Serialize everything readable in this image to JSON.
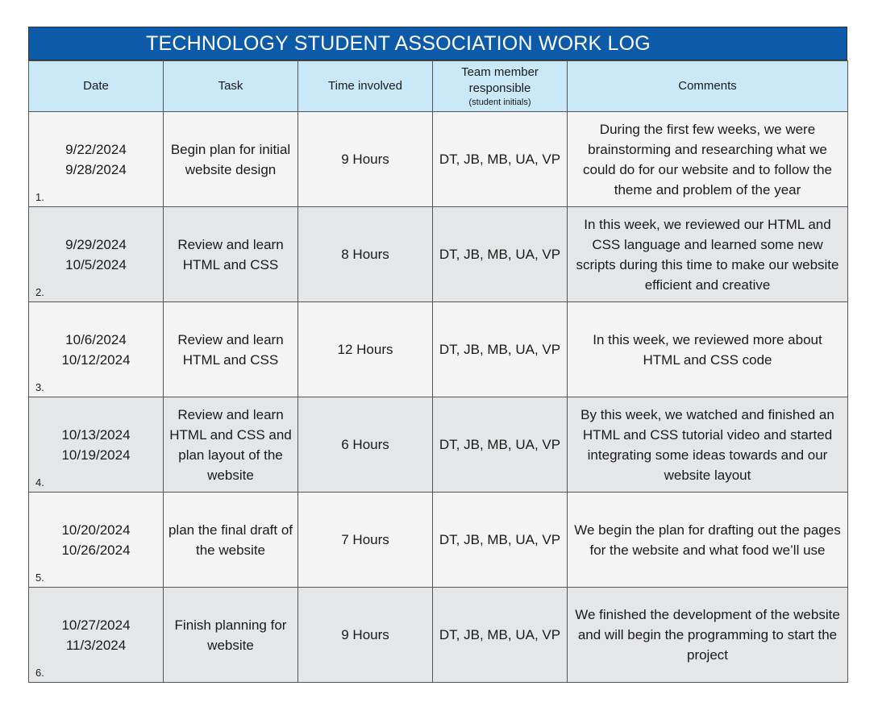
{
  "title": "TECHNOLOGY STUDENT ASSOCIATION WORK LOG",
  "headers": {
    "date": "Date",
    "task": "Task",
    "time": "Time involved",
    "team": "Team member responsible",
    "team_sub": "(student initials)",
    "comments": "Comments"
  },
  "rows": [
    {
      "num": "1.",
      "start": "9/22/2024",
      "end": "9/28/2024",
      "task": "Begin plan for initial website design",
      "time": "9 Hours",
      "team": "DT, JB, MB, UA, VP",
      "comment": "During the first few weeks, we were brainstorming and researching what we could do for our website and to follow the theme and problem of the year"
    },
    {
      "num": "2.",
      "start": "9/29/2024",
      "end": "10/5/2024",
      "task": "Review and learn HTML and CSS",
      "time": "8 Hours",
      "team": "DT, JB, MB, UA, VP",
      "comment": "In this week, we reviewed our HTML and CSS language and learned some new scripts during this time to make our website efficient and creative"
    },
    {
      "num": "3.",
      "start": "10/6/2024",
      "end": "10/12/2024",
      "task": "Review and learn HTML and CSS",
      "time": "12 Hours",
      "team": "DT, JB, MB, UA, VP",
      "comment": "In this week, we reviewed more about HTML and CSS code"
    },
    {
      "num": "4.",
      "start": "10/13/2024",
      "end": "10/19/2024",
      "task": "Review and learn HTML and CSS and plan layout of the website",
      "time": "6 Hours",
      "team": "DT, JB, MB, UA, VP",
      "comment": "By this week, we watched and finished an HTML and CSS tutorial video and started integrating some ideas towards and our website layout"
    },
    {
      "num": "5.",
      "start": "10/20/2024",
      "end": "10/26/2024",
      "task": "plan the final draft of the website",
      "time": "7 Hours",
      "team": "DT, JB, MB, UA, VP",
      "comment": "We begin the plan for drafting out the pages for the website and what food we’ll use"
    },
    {
      "num": "6.",
      "start": "10/27/2024",
      "end": "11/3/2024",
      "task": "Finish planning for website",
      "time": "9 Hours",
      "team": "DT, JB, MB, UA, VP",
      "comment": "We finished the development of the website and will begin the programming to start the project"
    }
  ]
}
